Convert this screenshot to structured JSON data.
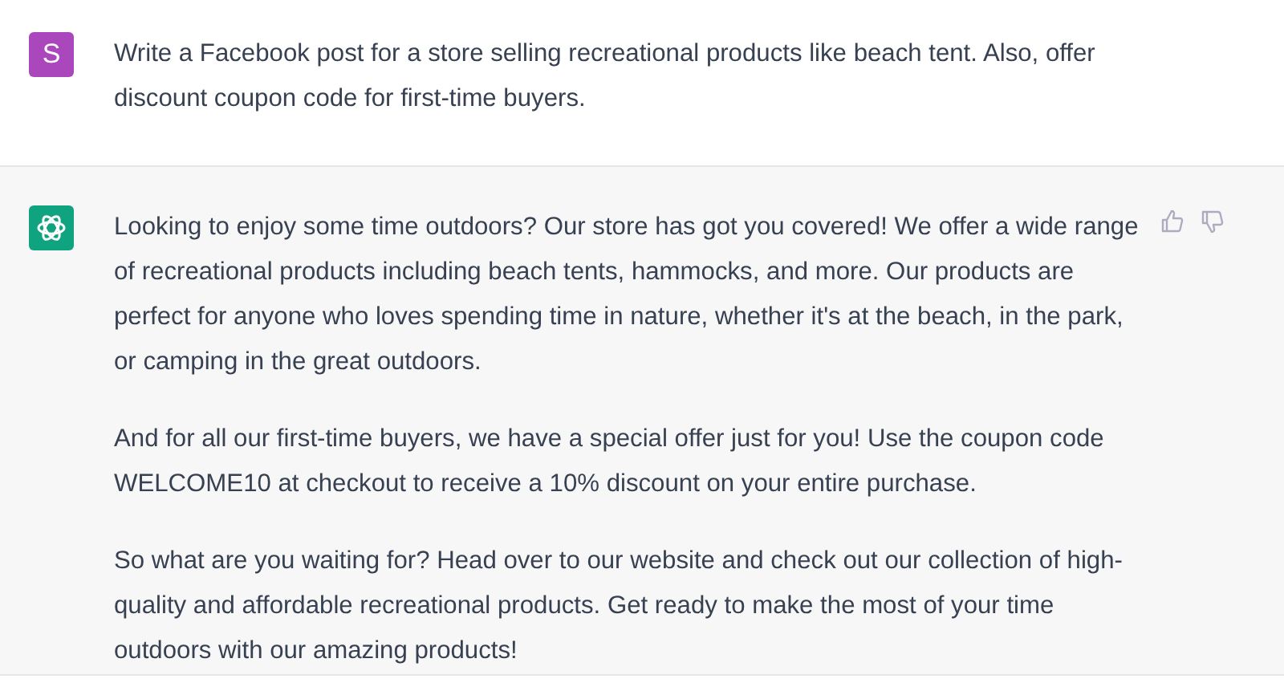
{
  "messages": [
    {
      "kind": "user",
      "avatar_letter": "S",
      "paragraphs": [
        "Write a Facebook post for a store selling recreational products like beach tent. Also, offer discount coupon code for first-time buyers."
      ]
    },
    {
      "kind": "assistant",
      "paragraphs": [
        "Looking to enjoy some time outdoors? Our store has got you covered! We offer a wide range of recreational products including beach tents, hammocks, and more. Our products are perfect for anyone who loves spending time in nature, whether it's at the beach, in the park, or camping in the great outdoors.",
        "And for all our first-time buyers, we have a special offer just for you! Use the coupon code WELCOME10 at checkout to receive a 10% discount on your entire purchase.",
        "So what are you waiting for? Head over to our website and check out our collection of high-quality and affordable recreational products. Get ready to make the most of your time outdoors with our amazing products!"
      ]
    }
  ]
}
